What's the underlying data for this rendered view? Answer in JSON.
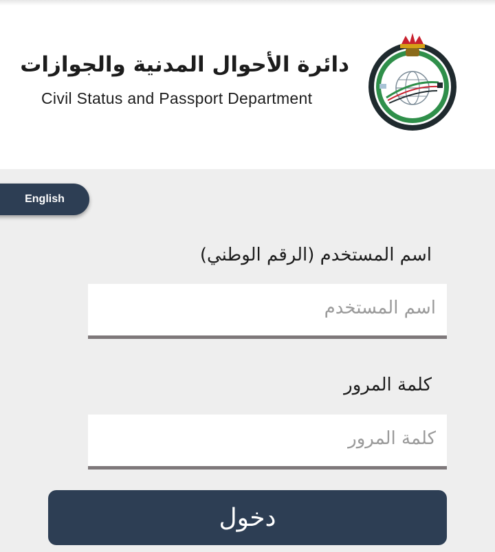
{
  "header": {
    "title_ar": "دائرة الأحوال المدنية والجوازات",
    "title_en": "Civil Status and Passport Department",
    "logo_icon": "jordan-crown-emblem"
  },
  "language_button": {
    "label": "English"
  },
  "form": {
    "username_label": "اسم المستخدم (الرقم الوطني)",
    "username_placeholder": "اسم المستخدم",
    "username_value": "",
    "password_label": "كلمة المرور",
    "password_placeholder": "كلمة المرور",
    "password_value": "",
    "submit_label": "دخول"
  },
  "colors": {
    "primary": "#2d3e54",
    "background": "#eeeeee",
    "input_border": "#7e787a",
    "logo_green": "#2f8f4a",
    "logo_dark": "#1f2a2e",
    "logo_red": "#c8202e"
  }
}
